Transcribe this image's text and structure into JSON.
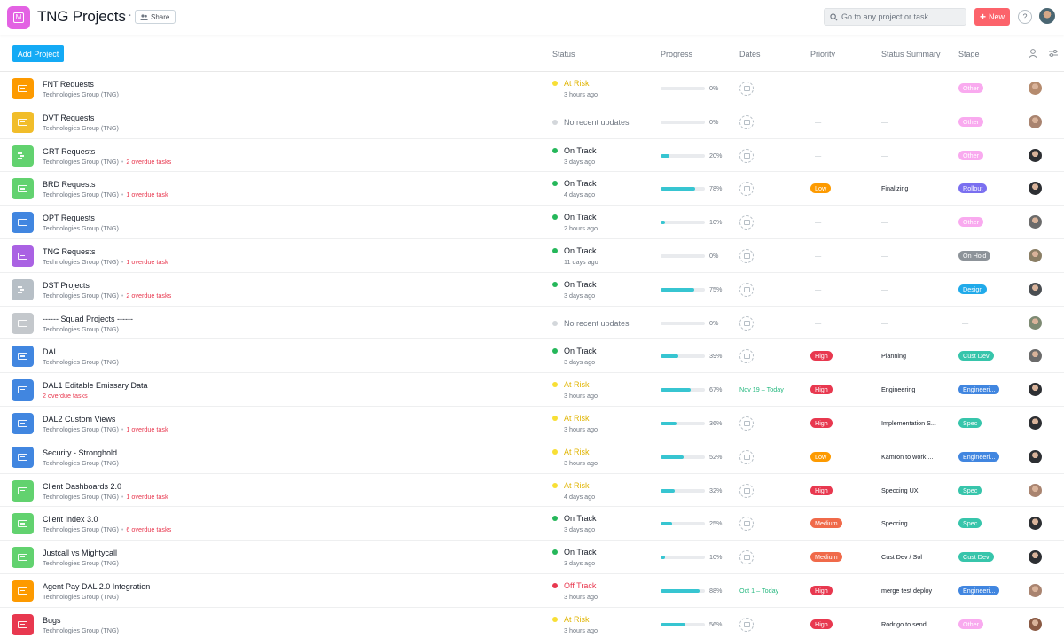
{
  "app": {
    "title": "TNG Projects",
    "icon_color": "#e362e3",
    "icon_letter": "M",
    "more_icon": "more-horizontal-icon",
    "share_label": "Share",
    "search_placeholder": "Go to any project or task...",
    "new_label": "New",
    "help_label": "?"
  },
  "toolbar": {
    "add_project_label": "Add Project"
  },
  "columns": {
    "status": "Status",
    "progress": "Progress",
    "dates": "Dates",
    "priority": "Priority",
    "status_summary": "Status Summary",
    "stage": "Stage"
  },
  "colors": {
    "on_track": "#25b75a",
    "at_risk": "#f8df35",
    "off_track": "#e8384f",
    "no_update": "#d3d7db",
    "progress": "#37c5d1",
    "priority_low": "#fd9a00",
    "priority_high": "#e8384f",
    "priority_medium": "#f06a4a",
    "stage_other": "#f9aaef",
    "stage_rollout": "#7a6ff0",
    "stage_onhold": "#8d9399",
    "stage_design": "#20aaea",
    "stage_custdev": "#37c5ab",
    "stage_engineering": "#4186e0",
    "stage_spec": "#37c5ab"
  },
  "rows": [
    {
      "name": "FNT Requests",
      "group": "Technologies Group (TNG)",
      "overdue": "",
      "icon_color": "#fd9a00",
      "icon": "list",
      "status": "At Risk",
      "status_color": "#e0b400",
      "dot": "#f8df35",
      "time": "3 hours ago",
      "progress": 0,
      "progress_label": "0%",
      "date": "",
      "priority": "",
      "priority_color": "",
      "summary": "",
      "stage": "Other",
      "stage_color": "#f9aaef",
      "avatar": "#b58b6e"
    },
    {
      "name": "DVT Requests",
      "group": "Technologies Group (TNG)",
      "overdue": "",
      "icon_color": "#f1bd2a",
      "icon": "list",
      "status": "No recent updates",
      "status_color": "#6f7782",
      "dot": "#d3d7db",
      "time": "",
      "progress": 0,
      "progress_label": "0%",
      "date": "",
      "priority": "",
      "priority_color": "",
      "summary": "",
      "stage": "Other",
      "stage_color": "#f9aaef",
      "avatar": "#a98470"
    },
    {
      "name": "GRT Requests",
      "group": "Technologies Group (TNG)",
      "overdue": "2 overdue tasks",
      "icon_color": "#62d26f",
      "icon": "board",
      "status": "On Track",
      "status_color": "#151b26",
      "dot": "#25b75a",
      "time": "3 days ago",
      "progress": 20,
      "progress_label": "20%",
      "date": "",
      "priority": "",
      "priority_color": "",
      "summary": "",
      "stage": "Other",
      "stage_color": "#f9aaef",
      "avatar": "#2d2f33"
    },
    {
      "name": "BRD Requests",
      "group": "Technologies Group (TNG)",
      "overdue": "1 overdue task",
      "icon_color": "#62d26f",
      "icon": "list",
      "status": "On Track",
      "status_color": "#151b26",
      "dot": "#25b75a",
      "time": "4 days ago",
      "progress": 78,
      "progress_label": "78%",
      "date": "",
      "priority": "Low",
      "priority_color": "#fd9a00",
      "summary": "Finalizing",
      "stage": "Rollout",
      "stage_color": "#7a6ff0",
      "avatar": "#2d2f33"
    },
    {
      "name": "OPT Requests",
      "group": "Technologies Group (TNG)",
      "overdue": "",
      "icon_color": "#4186e0",
      "icon": "list",
      "status": "On Track",
      "status_color": "#151b26",
      "dot": "#25b75a",
      "time": "2 hours ago",
      "progress": 10,
      "progress_label": "10%",
      "date": "",
      "priority": "",
      "priority_color": "",
      "summary": "",
      "stage": "Other",
      "stage_color": "#f9aaef",
      "avatar": "#6b6b6b"
    },
    {
      "name": "TNG Requests",
      "group": "Technologies Group (TNG)",
      "overdue": "1 overdue task",
      "icon_color": "#aa62e3",
      "icon": "list",
      "status": "On Track",
      "status_color": "#151b26",
      "dot": "#25b75a",
      "time": "11 days ago",
      "progress": 0,
      "progress_label": "0%",
      "date": "",
      "priority": "",
      "priority_color": "",
      "summary": "",
      "stage": "On Hold",
      "stage_color": "#8d9399",
      "avatar": "#8a7e65"
    },
    {
      "name": "DST Projects",
      "group": "Technologies Group (TNG)",
      "overdue": "2 overdue tasks",
      "icon_color": "#b7bfc6",
      "icon": "board",
      "status": "On Track",
      "status_color": "#151b26",
      "dot": "#25b75a",
      "time": "3 days ago",
      "progress": 75,
      "progress_label": "75%",
      "date": "",
      "priority": "",
      "priority_color": "",
      "summary": "",
      "stage": "Design",
      "stage_color": "#20aaea",
      "avatar": "#4a4e52"
    },
    {
      "name": "------ Squad Projects ------",
      "group": "Technologies Group (TNG)",
      "overdue": "",
      "icon_color": "#c4c8cc",
      "icon": "list",
      "status": "No recent updates",
      "status_color": "#6f7782",
      "dot": "#d3d7db",
      "time": "",
      "progress": 0,
      "progress_label": "0%",
      "date": "",
      "priority": "",
      "priority_color": "",
      "summary": "",
      "stage": "",
      "stage_color": "",
      "avatar": "#7d8a73"
    },
    {
      "name": "DAL",
      "group": "Technologies Group (TNG)",
      "overdue": "",
      "icon_color": "#4186e0",
      "icon": "list",
      "status": "On Track",
      "status_color": "#151b26",
      "dot": "#25b75a",
      "time": "3 days ago",
      "progress": 39,
      "progress_label": "39%",
      "date": "",
      "priority": "High",
      "priority_color": "#e8384f",
      "summary": "Planning",
      "stage": "Cust Dev",
      "stage_color": "#37c5ab",
      "avatar": "#6b6b6b"
    },
    {
      "name": "DAL1 Editable Emissary Data",
      "group": "",
      "overdue": "2 overdue tasks",
      "icon_color": "#4186e0",
      "icon": "list",
      "status": "At Risk",
      "status_color": "#e0b400",
      "dot": "#f8df35",
      "time": "3 hours ago",
      "progress": 67,
      "progress_label": "67%",
      "date": "Nov 19 – Today",
      "priority": "High",
      "priority_color": "#e8384f",
      "summary": "Engineering",
      "stage": "Engineeri...",
      "stage_color": "#4186e0",
      "avatar": "#2d2f33"
    },
    {
      "name": "DAL2 Custom Views",
      "group": "Technologies Group (TNG)",
      "overdue": "1 overdue task",
      "icon_color": "#4186e0",
      "icon": "list",
      "status": "At Risk",
      "status_color": "#e0b400",
      "dot": "#f8df35",
      "time": "3 hours ago",
      "progress": 36,
      "progress_label": "36%",
      "date": "",
      "priority": "High",
      "priority_color": "#e8384f",
      "summary": "Implementation S...",
      "stage": "Spec",
      "stage_color": "#37c5ab",
      "avatar": "#2d2f33"
    },
    {
      "name": "Security - Stronghold",
      "group": "Technologies Group (TNG)",
      "overdue": "",
      "icon_color": "#4186e0",
      "icon": "list",
      "status": "At Risk",
      "status_color": "#e0b400",
      "dot": "#f8df35",
      "time": "3 hours ago",
      "progress": 52,
      "progress_label": "52%",
      "date": "",
      "priority": "Low",
      "priority_color": "#fd9a00",
      "summary": "Kamron to work ...",
      "stage": "Engineeri...",
      "stage_color": "#4186e0",
      "avatar": "#2d2f33"
    },
    {
      "name": "Client Dashboards 2.0",
      "group": "Technologies Group (TNG)",
      "overdue": "1 overdue task",
      "icon_color": "#62d26f",
      "icon": "list",
      "status": "At Risk",
      "status_color": "#e0b400",
      "dot": "#f8df35",
      "time": "4 days ago",
      "progress": 32,
      "progress_label": "32%",
      "date": "",
      "priority": "High",
      "priority_color": "#e8384f",
      "summary": "Speccing UX",
      "stage": "Spec",
      "stage_color": "#37c5ab",
      "avatar": "#a98470"
    },
    {
      "name": "Client Index 3.0",
      "group": "Technologies Group (TNG)",
      "overdue": "6 overdue tasks",
      "icon_color": "#62d26f",
      "icon": "list",
      "status": "On Track",
      "status_color": "#151b26",
      "dot": "#25b75a",
      "time": "3 days ago",
      "progress": 25,
      "progress_label": "25%",
      "date": "",
      "priority": "Medium",
      "priority_color": "#f06a4a",
      "summary": "Speccing",
      "stage": "Spec",
      "stage_color": "#37c5ab",
      "avatar": "#2d2f33"
    },
    {
      "name": "Justcall vs Mightycall",
      "group": "Technologies Group (TNG)",
      "overdue": "",
      "icon_color": "#62d26f",
      "icon": "list",
      "status": "On Track",
      "status_color": "#151b26",
      "dot": "#25b75a",
      "time": "3 days ago",
      "progress": 10,
      "progress_label": "10%",
      "date": "",
      "priority": "Medium",
      "priority_color": "#f06a4a",
      "summary": "Cust Dev / Sol",
      "stage": "Cust Dev",
      "stage_color": "#37c5ab",
      "avatar": "#2d2f33"
    },
    {
      "name": "Agent Pay DAL 2.0 Integration",
      "group": "Technologies Group (TNG)",
      "overdue": "",
      "icon_color": "#fd9a00",
      "icon": "list",
      "status": "Off Track",
      "status_color": "#e8384f",
      "dot": "#e8384f",
      "time": "3 hours ago",
      "progress": 88,
      "progress_label": "88%",
      "date": "Oct 1 – Today",
      "priority": "High",
      "priority_color": "#e8384f",
      "summary": "merge test deploy",
      "stage": "Engineeri...",
      "stage_color": "#4186e0",
      "avatar": "#a98470"
    },
    {
      "name": "Bugs",
      "group": "Technologies Group (TNG)",
      "overdue": "",
      "icon_color": "#e8384f",
      "icon": "list",
      "status": "At Risk",
      "status_color": "#e0b400",
      "dot": "#f8df35",
      "time": "3 hours ago",
      "progress": 56,
      "progress_label": "56%",
      "date": "",
      "priority": "High",
      "priority_color": "#e8384f",
      "summary": "Rodrigo to send ...",
      "stage": "Other",
      "stage_color": "#f9aaef",
      "avatar": "#8a5a44"
    }
  ]
}
